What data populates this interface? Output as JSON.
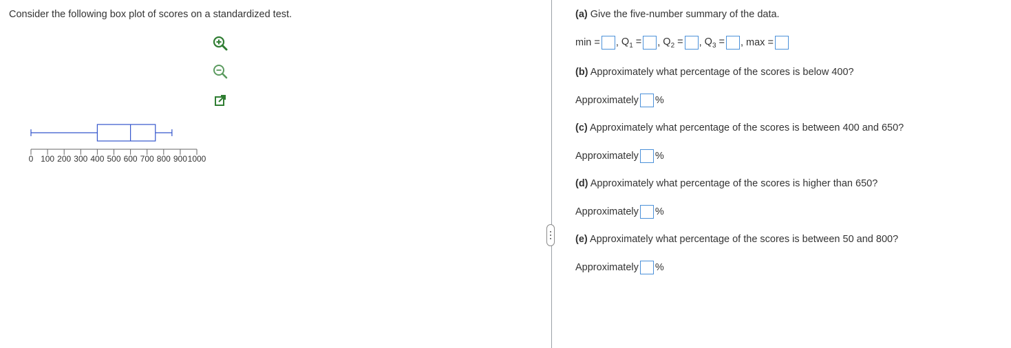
{
  "left_panel": {
    "prompt": "Consider the following box plot of scores on a standardized test."
  },
  "boxplot": {
    "min": 0,
    "q1": 400,
    "median": 600,
    "q3": 750,
    "max": 850,
    "axis_ticks": [
      "0",
      "100",
      "200",
      "300",
      "400",
      "500",
      "600",
      "700",
      "800",
      "900",
      "1000"
    ],
    "axis_min": 0,
    "axis_max": 1000,
    "color": "#3355cc"
  },
  "tools": {
    "zoom_in_icon": "zoom-in-icon",
    "zoom_out_icon": "zoom-out-icon",
    "popout_icon": "popout-icon"
  },
  "questions": {
    "a": {
      "prefix": "(a)",
      "text": "Give the five-number summary of the data.",
      "min_label": "min =",
      "q1_label": "Q",
      "q1_sub": "1",
      "q2_label": "Q",
      "q2_sub": "2",
      "q3_label": "Q",
      "q3_sub": "3",
      "max_label": "max =",
      "eq": "=",
      "comma": ","
    },
    "b": {
      "prefix": "(b)",
      "text": "Approximately what percentage of the scores is below 400?",
      "answer_prefix": "Approximately",
      "unit": "%"
    },
    "c": {
      "prefix": "(c)",
      "text": "Approximately what percentage of the scores is between 400 and 650?",
      "answer_prefix": "Approximately",
      "unit": "%"
    },
    "d": {
      "prefix": "(d)",
      "text": "Approximately what percentage of the scores is higher than 650?",
      "answer_prefix": "Approximately",
      "unit": "%"
    },
    "e": {
      "prefix": "(e)",
      "text": "Approximately what percentage of the scores is between 50 and 800?",
      "answer_prefix": "Approximately",
      "unit": "%"
    }
  },
  "colors": {
    "accent": "#4a90d9",
    "text": "#333333",
    "plot": "#3355cc"
  }
}
